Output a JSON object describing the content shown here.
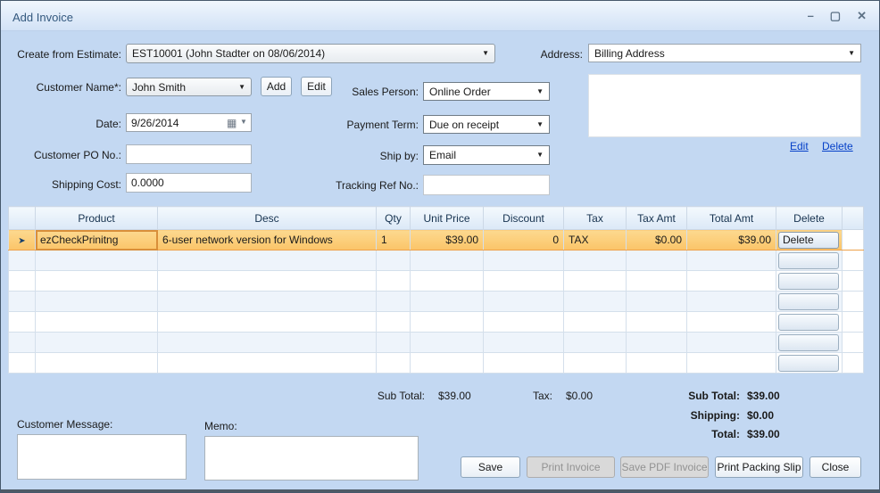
{
  "window": {
    "title": "Add Invoice",
    "controls": {
      "minimize": "–",
      "maximize": "▢",
      "close": "✕"
    }
  },
  "form": {
    "estimate": {
      "label": "Create from Estimate:",
      "value": "EST10001 (John Stadter on 08/06/2014)"
    },
    "customer": {
      "label": "Customer Name*:",
      "value": "John Smith",
      "add_label": "Add",
      "edit_label": "Edit"
    },
    "date": {
      "label": "Date:",
      "value": "9/26/2014"
    },
    "po": {
      "label": "Customer PO No.:",
      "value": ""
    },
    "shipping_cost": {
      "label": "Shipping Cost:",
      "value": "0.0000"
    },
    "sales_person": {
      "label": "Sales Person:",
      "value": "Online Order"
    },
    "payment_term": {
      "label": "Payment Term:",
      "value": "Due on receipt"
    },
    "ship_by": {
      "label": "Ship by:",
      "value": "Email"
    },
    "tracking": {
      "label": "Tracking Ref No.:",
      "value": ""
    },
    "address": {
      "label": "Address:",
      "value": "Billing Address",
      "text": "",
      "edit_link": "Edit",
      "delete_link": "Delete"
    }
  },
  "grid": {
    "columns": [
      "Product",
      "Desc",
      "Qty",
      "Unit Price",
      "Discount",
      "Tax",
      "Tax Amt",
      "Total Amt",
      "Delete"
    ],
    "rows": [
      {
        "product": "ezCheckPrinitng",
        "desc": "6-user network version for Windows",
        "qty": "1",
        "unit_price": "$39.00",
        "discount": "0",
        "tax": "TAX",
        "tax_amt": "$0.00",
        "total_amt": "$39.00",
        "delete_label": "Delete"
      }
    ],
    "empty_row_count": 6
  },
  "totals_line": {
    "sub_total_label": "Sub Total:",
    "sub_total_value": "$39.00",
    "tax_label": "Tax:",
    "tax_value": "$0.00"
  },
  "summary": {
    "sub_total_label": "Sub Total:",
    "sub_total_value": "$39.00",
    "shipping_label": "Shipping:",
    "shipping_value": "$0.00",
    "total_label": "Total:",
    "total_value": "$39.00"
  },
  "messages": {
    "customer_message_label": "Customer Message:",
    "memo_label": "Memo:"
  },
  "footer": {
    "save": "Save",
    "print_invoice": "Print Invoice",
    "save_pdf": "Save PDF Invoice",
    "print_packing_slip": "Print Packing Slip",
    "close": "Close"
  },
  "colors": {
    "dialog_background": "#c3d8f2",
    "titlebar_gradient_top": "#f0f6fd",
    "selected_row": "#fbc468",
    "selected_cell_outline": "#d98f3a",
    "grid_header": "#dbe8f7",
    "link_blue": "#0540c8",
    "disabled_button": "#d9d9d9"
  }
}
